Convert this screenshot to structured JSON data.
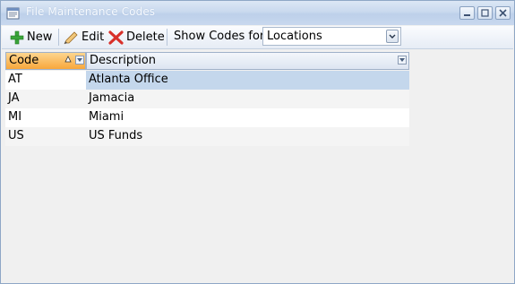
{
  "window": {
    "title": "File Maintenance Codes"
  },
  "toolbar": {
    "new_label": "New",
    "edit_label": "Edit",
    "delete_label": "Delete",
    "show_codes_label": "Show Codes for",
    "show_codes_value": "Locations"
  },
  "grid": {
    "columns": [
      "Code",
      "Description"
    ],
    "rows": [
      {
        "code": "AT",
        "description": "Atlanta Office",
        "selected": true
      },
      {
        "code": "JA",
        "description": "Jamacia",
        "selected": false
      },
      {
        "code": "MI",
        "description": "Miami",
        "selected": false
      },
      {
        "code": "US",
        "description": "US Funds",
        "selected": false
      }
    ]
  },
  "colors": {
    "selected_row": "#c4d7ec",
    "alt_row": "#f4f4f4",
    "sorted_header": "#f8a73c"
  }
}
